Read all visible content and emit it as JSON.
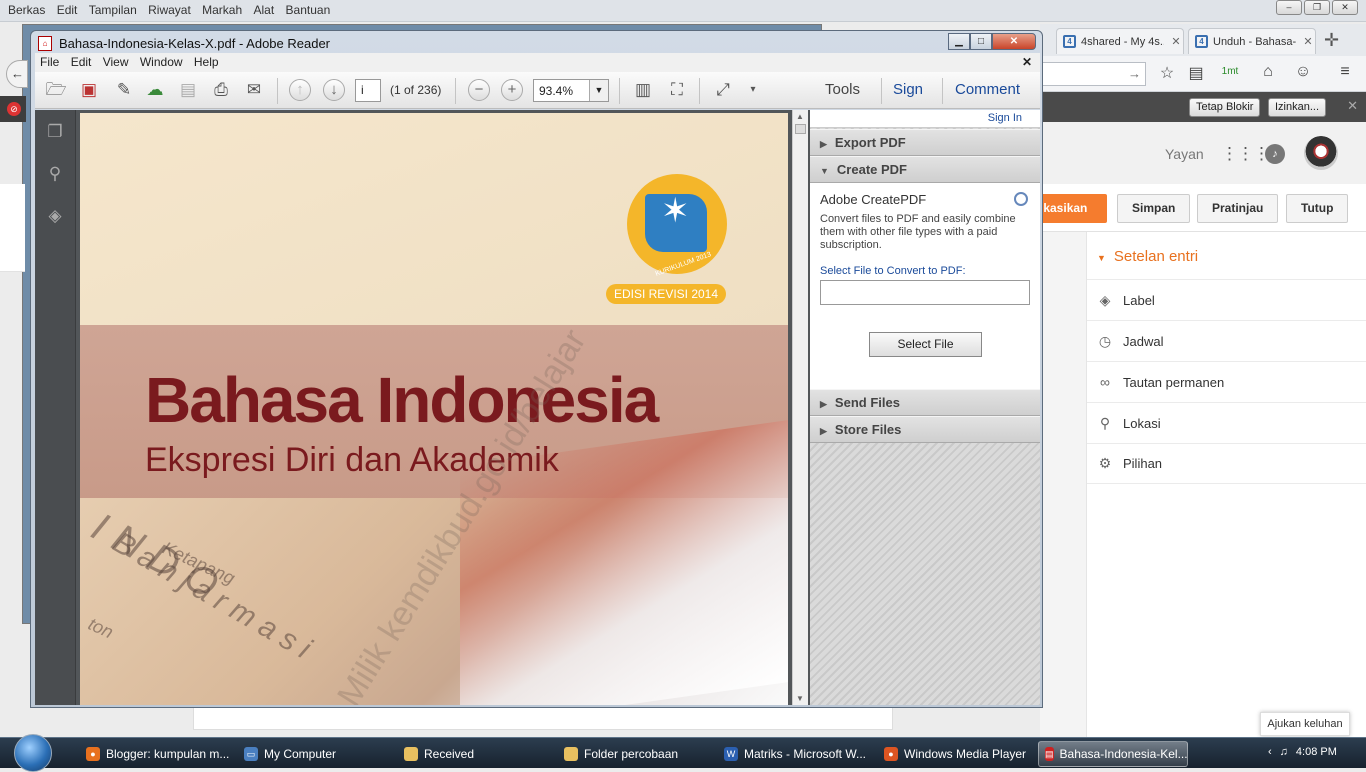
{
  "firefox": {
    "menu": [
      "Berkas",
      "Edit",
      "Tampilan",
      "Riwayat",
      "Markah",
      "Alat",
      "Bantuan"
    ],
    "tabs": [
      {
        "label": "4shared - My 4s...",
        "icon": "4shared-icon"
      },
      {
        "label": "Unduh - Bahasa-...",
        "icon": "4shared-icon"
      }
    ],
    "notification": {
      "block_label": "Tetap Blokir",
      "allow_label": "Izinkan..."
    }
  },
  "blogger": {
    "user": "Yayan",
    "publish_label": "ikasikan",
    "buttons": [
      "Simpan",
      "Pratinjau",
      "Tutup"
    ],
    "settings_title": "Setelan entri",
    "settings": [
      {
        "label": "Label",
        "icon": "tag-icon"
      },
      {
        "label": "Jadwal",
        "icon": "clock-icon"
      },
      {
        "label": "Tautan permanen",
        "icon": "link-icon"
      },
      {
        "label": "Lokasi",
        "icon": "location-pin-icon"
      },
      {
        "label": "Pilihan",
        "icon": "gear-icon"
      }
    ],
    "feedback_label": "Ajukan keluhan"
  },
  "reader": {
    "title": "Bahasa-Indonesia-Kelas-X.pdf - Adobe Reader",
    "menu": [
      "File",
      "Edit",
      "View",
      "Window",
      "Help"
    ],
    "page_input": "i",
    "page_of": "(1 of 236)",
    "zoom": "93.4%",
    "links": {
      "tools": "Tools",
      "sign": "Sign",
      "comment": "Comment"
    },
    "sign_in": "Sign In",
    "panels": {
      "export": "Export PDF",
      "create": "Create PDF",
      "send": "Send Files",
      "store": "Store Files"
    },
    "create_pdf": {
      "heading": "Adobe CreatePDF",
      "description": "Convert files to PDF and easily combine them with other file types with a paid subscription.",
      "select_label": "Select File to Convert to PDF:",
      "file_value": "",
      "button": "Select File"
    }
  },
  "document": {
    "title": "Bahasa Indonesia",
    "subtitle": "Ekspresi Diri dan Akademik",
    "edition": "EDISI REVISI 2014",
    "logo_text": "KURIKULUM 2013",
    "watermark": "Milik kemdikbud.go.id/belajar",
    "map_labels": [
      "Ketapang",
      "INDO",
      "Banjarmasi",
      "ton"
    ]
  },
  "taskbar": {
    "items": [
      {
        "label": "Blogger: kumpulan m...",
        "color": "#e8711f"
      },
      {
        "label": "My Computer",
        "color": "#4a7fc0"
      },
      {
        "label": "Received",
        "color": "#e8c060"
      },
      {
        "label": "Folder percobaan",
        "color": "#e8c060"
      },
      {
        "label": "Matriks - Microsoft W...",
        "color": "#2b5fb0"
      },
      {
        "label": "Windows Media Player",
        "color": "#dd5522"
      },
      {
        "label": "Bahasa-Indonesia-Kel...",
        "color": "#cc2222"
      }
    ],
    "time": "4:08 PM"
  }
}
